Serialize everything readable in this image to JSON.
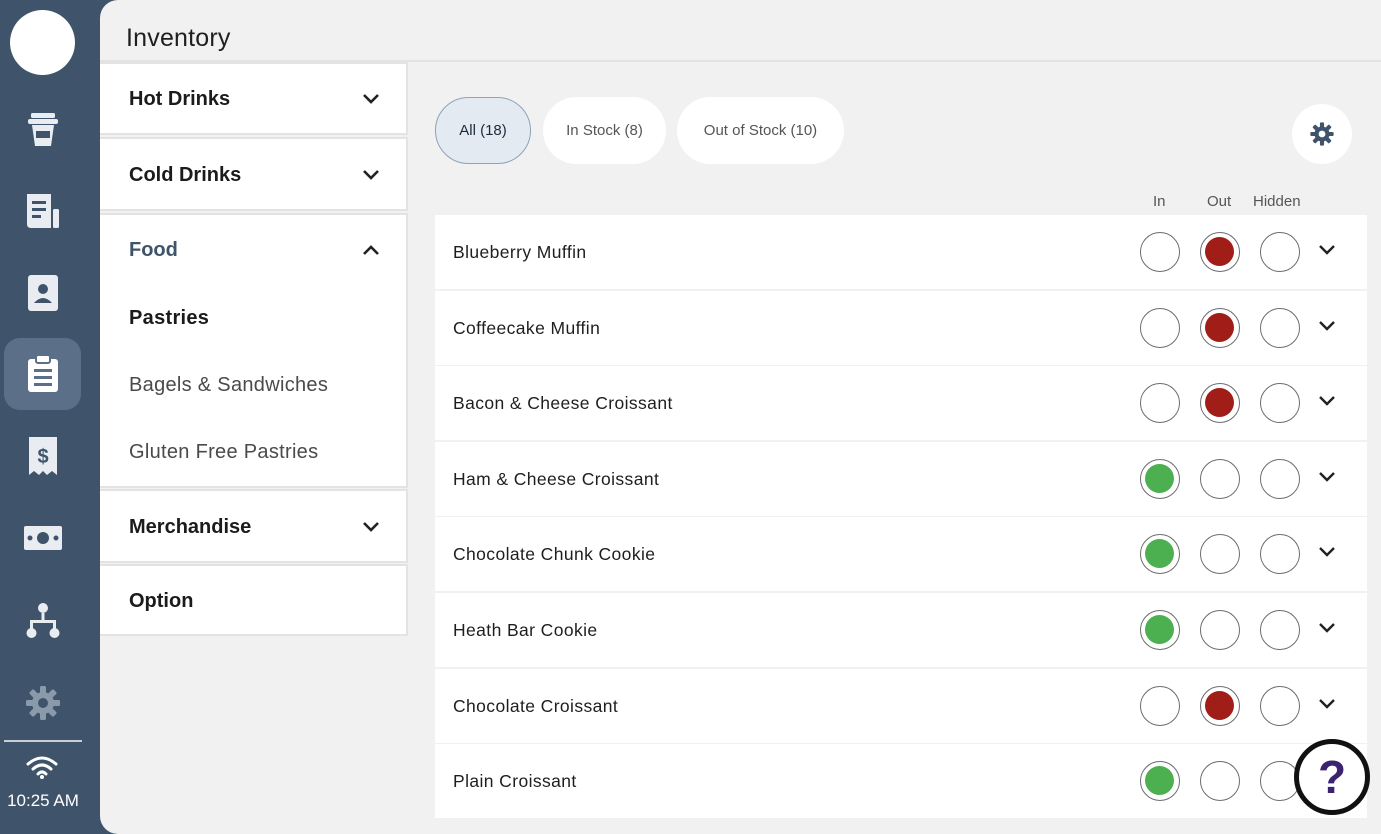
{
  "colors": {
    "rail": "#3f546a",
    "in_fill": "#4caf50",
    "out_fill": "#a11d18",
    "accent": "#3f546a"
  },
  "rail": {
    "icons": [
      "drink-cup-icon",
      "orders-icon",
      "customers-icon",
      "inventory-icon",
      "receipt-icon",
      "cash-icon",
      "org-chart-icon",
      "settings-icon"
    ],
    "active": "inventory-icon",
    "time": "10:25 AM"
  },
  "header": {
    "title": "Inventory"
  },
  "categories": [
    {
      "label": "Hot Drinks",
      "open": false
    },
    {
      "label": "Cold Drinks",
      "open": false
    },
    {
      "label": "Food",
      "open": true,
      "subs": [
        "Pastries",
        "Bagels & Sandwiches",
        "Gluten Free Pastries"
      ],
      "selected": "Pastries"
    },
    {
      "label": "Merchandise",
      "open": false
    },
    {
      "label": "Option",
      "open": false
    }
  ],
  "filters": {
    "all": "All (18)",
    "in_stock": "In Stock (8)",
    "out_of_stock": "Out of Stock (10)",
    "active": "all"
  },
  "columns": {
    "in": "In",
    "out": "Out",
    "hidden": "Hidden"
  },
  "items": [
    {
      "name": "Blueberry Muffin",
      "status": "out"
    },
    {
      "name": "Coffeecake Muffin",
      "status": "out"
    },
    {
      "name": "Bacon & Cheese Croissant",
      "status": "out"
    },
    {
      "name": "Ham & Cheese Croissant",
      "status": "in"
    },
    {
      "name": "Chocolate Chunk Cookie",
      "status": "in"
    },
    {
      "name": "Heath Bar Cookie",
      "status": "in"
    },
    {
      "name": "Chocolate Croissant",
      "status": "out"
    },
    {
      "name": "Plain Croissant",
      "status": "in"
    }
  ],
  "help": {
    "label": "?"
  }
}
